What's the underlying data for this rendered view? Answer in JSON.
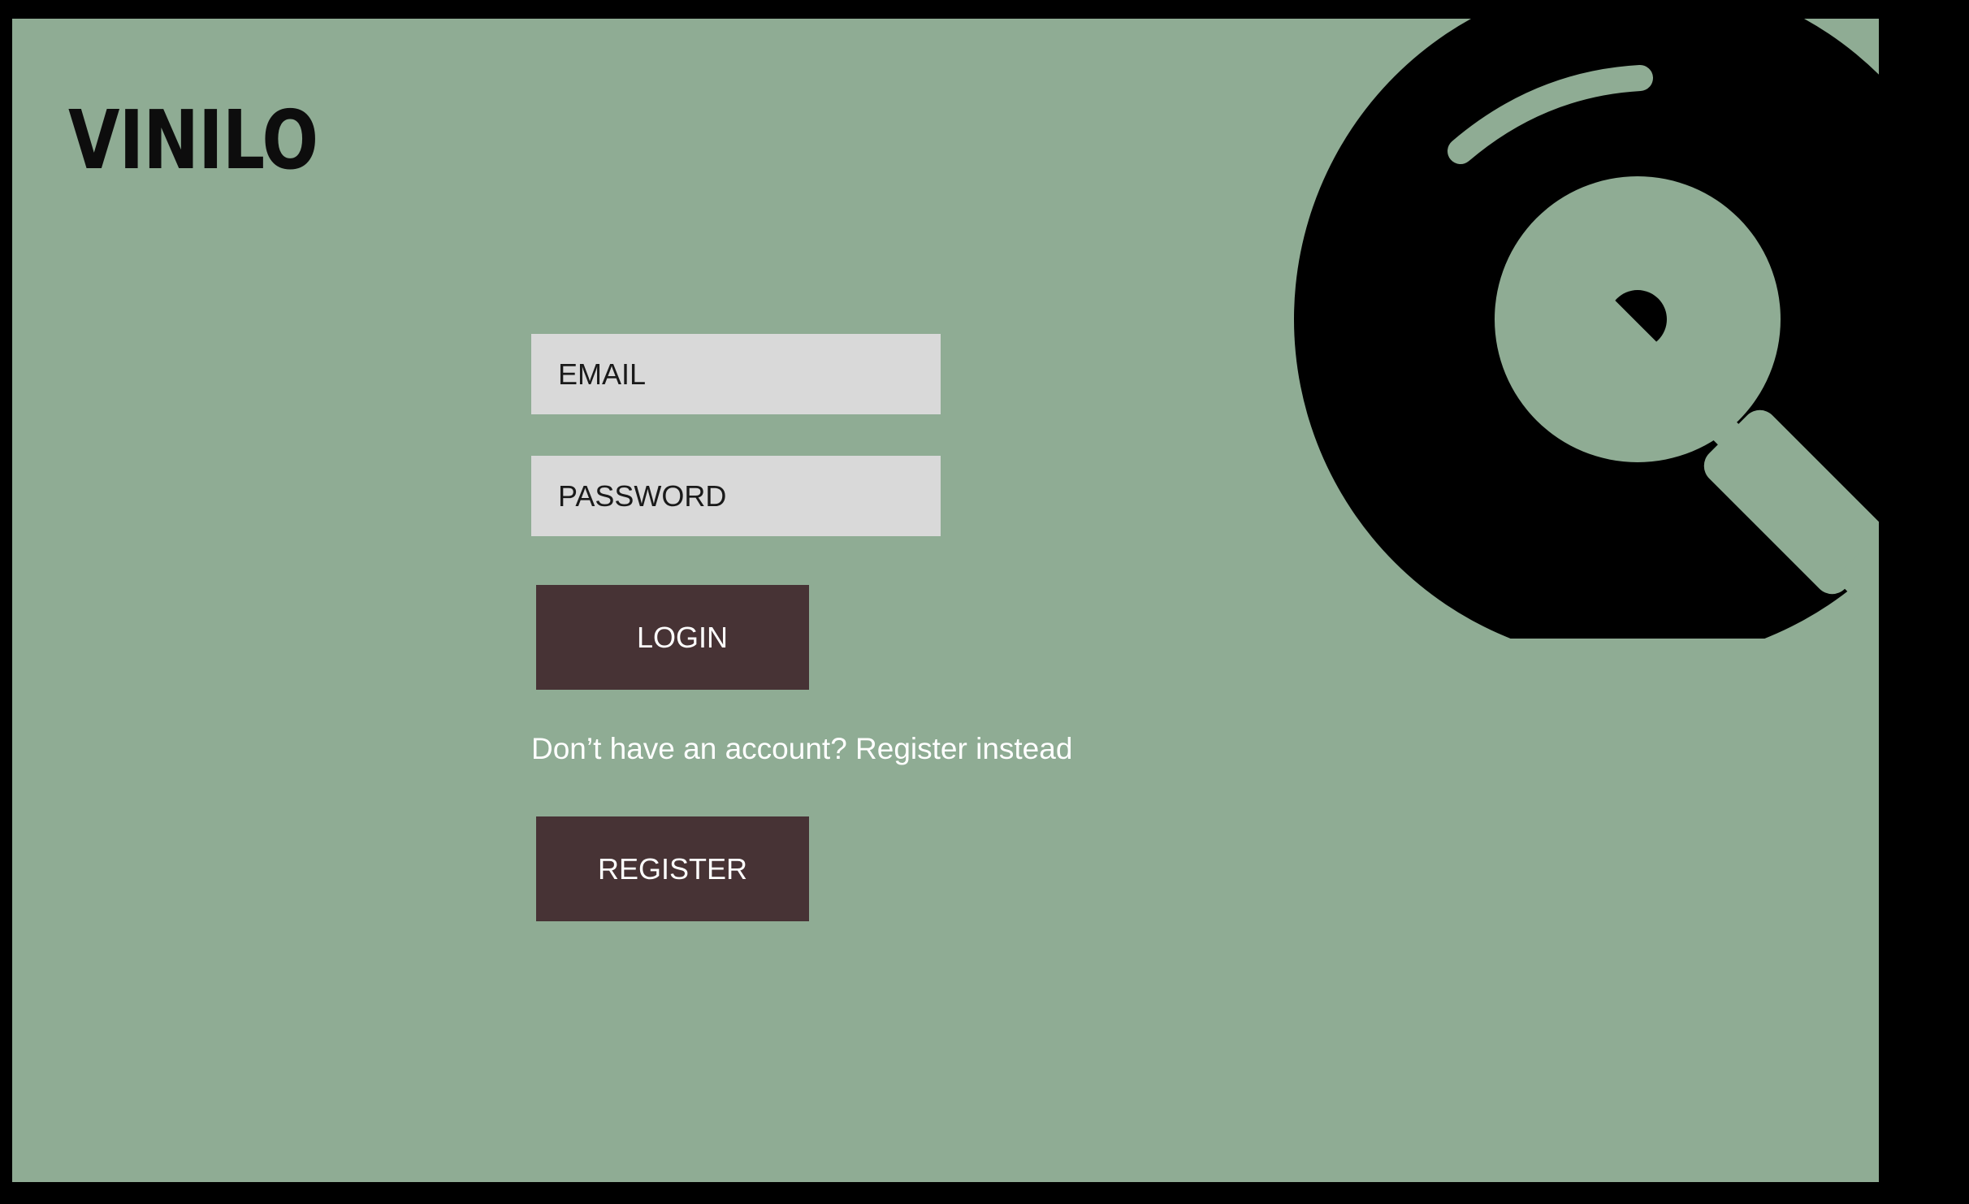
{
  "app": {
    "logo": "VINILO"
  },
  "form": {
    "email_placeholder": "EMAIL",
    "password_placeholder": "PASSWORD",
    "login_label": "LOGIN",
    "register_prompt": "Don’t have an account? Register instead",
    "register_label": "REGISTER"
  },
  "icons": {
    "record_player": "vinyl-record-icon"
  },
  "colors": {
    "background": "#8fac94",
    "button": "#473335",
    "input": "#d9d9d9",
    "frame": "#000000"
  }
}
